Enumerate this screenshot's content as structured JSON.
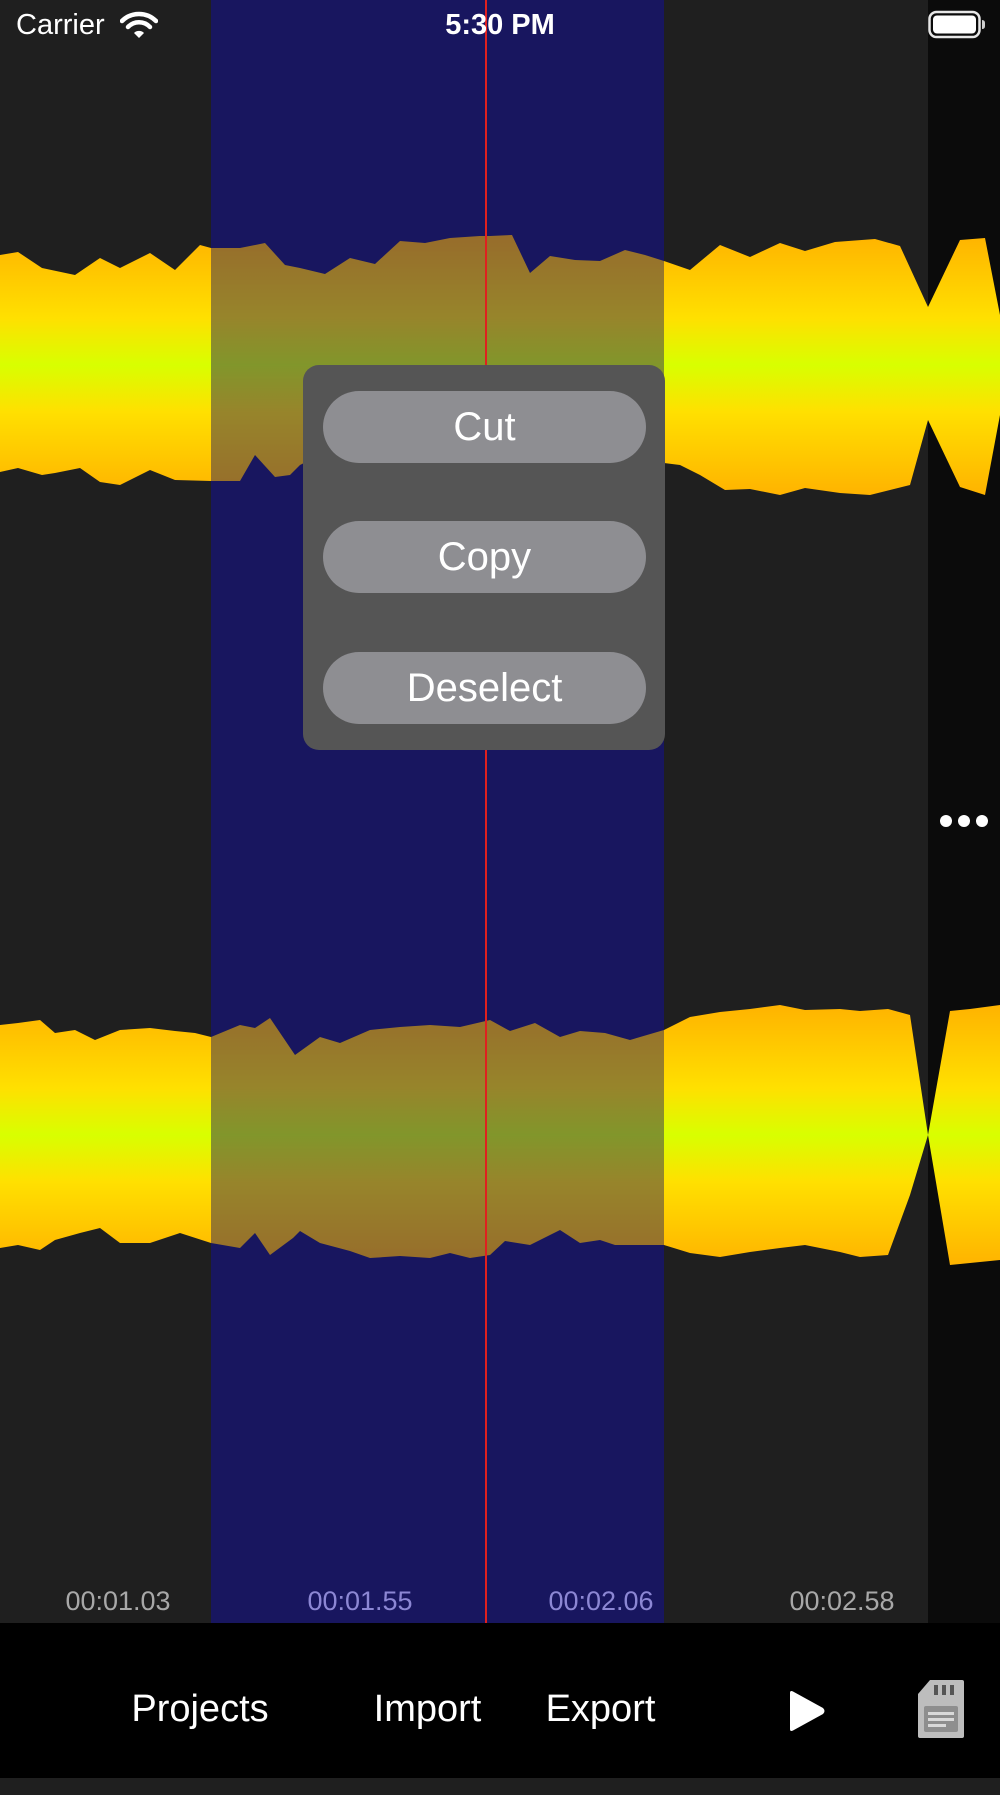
{
  "status_bar": {
    "carrier": "Carrier",
    "time": "5:30 PM"
  },
  "timeline": {
    "labels": [
      "00:01.03",
      "00:01.55",
      "00:02.06",
      "00:02.58"
    ]
  },
  "context_menu": {
    "cut_label": "Cut",
    "copy_label": "Copy",
    "deselect_label": "Deselect"
  },
  "toolbar": {
    "projects_label": "Projects",
    "import_label": "Import",
    "export_label": "Export"
  },
  "icons": {
    "wifi": "wifi-icon",
    "battery": "battery-icon",
    "more": "more-horizontal-icon",
    "play": "play-icon",
    "storage": "sd-card-icon"
  },
  "colors": {
    "background": "#1f1f1f",
    "selection": "#18165f",
    "playhead": "#e0201f",
    "wave_edge": "#ffb300",
    "wave_center": "#d8ff00",
    "menu_bg": "#555555",
    "menu_button": "#8e8e92"
  }
}
